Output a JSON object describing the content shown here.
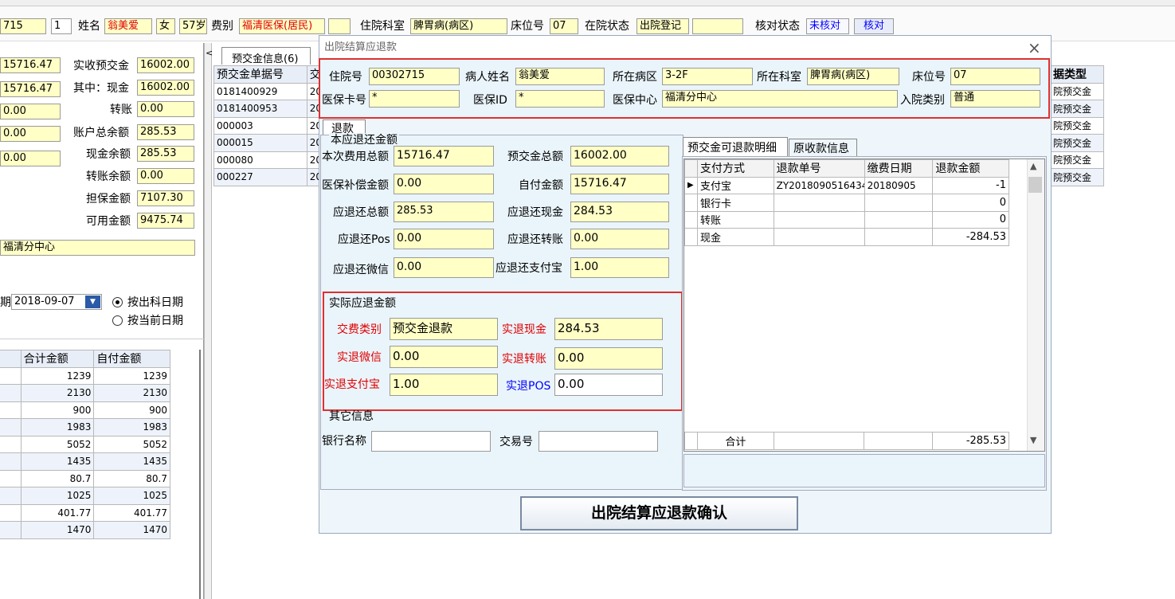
{
  "topbar": {
    "inpatient_no": "715",
    "number": "1",
    "name_label": "姓名",
    "name": "翁美爱",
    "gender": "女",
    "age": "57岁",
    "fee_label": "费别",
    "fee_type": "福清医保(居民)",
    "dept_label": "住院科室",
    "dept": "脾胃病(病区)",
    "bed_label": "床位号",
    "bed": "07",
    "status_label": "在院状态",
    "status": "出院登记",
    "check_label": "核对状态",
    "check_status": "未核对",
    "check_button": "核对"
  },
  "left": {
    "values1": [
      "15716.47",
      "15716.47",
      "0.00",
      "0.00",
      "0.00"
    ],
    "rows": [
      {
        "label": "实收预交金",
        "value": "16002.00"
      },
      {
        "label": "其中：现金",
        "value": "16002.00"
      },
      {
        "label": "转账",
        "value": "0.00"
      },
      {
        "label": "账户总余额",
        "value": "285.53"
      },
      {
        "label": "现金余额",
        "value": "285.53"
      },
      {
        "label": "转账余额",
        "value": "0.00"
      },
      {
        "label": "担保金额",
        "value": "7107.30"
      },
      {
        "label": "可用金额",
        "value": "9475.74"
      }
    ],
    "center": "福清分中心",
    "date_label": "期",
    "date": "2018-09-07",
    "radio1": "按出科日期",
    "radio2": "按当前日期",
    "table_headers": [
      "合计金额",
      "自付金额"
    ],
    "table_rows": [
      [
        "1239",
        "1239"
      ],
      [
        "2130",
        "2130"
      ],
      [
        "900",
        "900"
      ],
      [
        "1983",
        "1983"
      ],
      [
        "5052",
        "5052"
      ],
      [
        "1435",
        "1435"
      ],
      [
        "80.7",
        "80.7"
      ],
      [
        "1025",
        "1025"
      ],
      [
        "401.77",
        "401.77"
      ],
      [
        "1470",
        "1470"
      ]
    ]
  },
  "mid": {
    "tab": "预交金信息(6)",
    "header": "预交金单据号",
    "header2": "交",
    "rows": [
      [
        "0181400929",
        "20"
      ],
      [
        "0181400953",
        "20"
      ],
      [
        "000003",
        "20"
      ],
      [
        "000015",
        "20"
      ],
      [
        "000080",
        "20"
      ],
      [
        "000227",
        "20"
      ]
    ]
  },
  "right": {
    "header": "据类型",
    "rows": [
      "院预交金",
      "院预交金",
      "院预交金",
      "院预交金",
      "院预交金",
      "院预交金"
    ]
  },
  "dialog": {
    "title": "出院结算应退款",
    "close": "×",
    "info": {
      "inpatient_no_label": "住院号",
      "inpatient_no": "00302715",
      "name_label": "病人姓名",
      "name": "翁美爱",
      "ward_label": "所在病区",
      "ward": "3-2F",
      "dept_label": "所在科室",
      "dept": "脾胃病(病区)",
      "bed_label": "床位号",
      "bed": "07",
      "card_label": "医保卡号",
      "card": "*",
      "insid_label": "医保ID",
      "insid": "*",
      "center_label": "医保中心",
      "center": "福清分中心",
      "admit_label": "入院类别",
      "admit": "普通"
    },
    "tab_refund": "退款",
    "section1": "本应退还金额",
    "total_fee_label": "本次费用总额",
    "total_fee": "15716.47",
    "deposit_total_label": "预交金总额",
    "deposit_total": "16002.00",
    "insurance_label": "医保补偿金额",
    "insurance": "0.00",
    "selfpay_label": "自付金额",
    "selfpay": "15716.47",
    "refund_total_label": "应退还总额",
    "refund_total": "285.53",
    "refund_cash_label": "应退还现金",
    "refund_cash": "284.53",
    "refund_pos_label": "应退还Pos",
    "refund_pos": "0.00",
    "refund_transfer_label": "应退还转账",
    "refund_transfer": "0.00",
    "refund_wechat_label": "应退还微信",
    "refund_wechat": "0.00",
    "refund_alipay_label": "应退还支付宝",
    "refund_alipay": "1.00",
    "section2": "实际应退金额",
    "pay_type_label": "交费类别",
    "pay_type": "预交金退款",
    "act_cash_label": "实退现金",
    "act_cash": "284.53",
    "act_wechat_label": "实退微信",
    "act_wechat": "0.00",
    "act_transfer_label": "实退转账",
    "act_transfer": "0.00",
    "act_alipay_label": "实退支付宝",
    "act_alipay": "1.00",
    "act_pos_label": "实退POS",
    "act_pos": "0.00",
    "section3": "其它信息",
    "bank_label": "银行名称",
    "bank": "",
    "trade_label": "交易号",
    "trade": "",
    "tab_detail": "预交金可退款明细",
    "tab_orig": "原收款信息",
    "grid_headers": [
      "支付方式",
      "退款单号",
      "缴费日期",
      "退款金额"
    ],
    "grid_rows": [
      [
        "支付宝",
        "ZY2018090516434",
        "20180905",
        "-1"
      ],
      [
        "银行卡",
        "",
        "",
        "0"
      ],
      [
        "转账",
        "",
        "",
        "0"
      ],
      [
        "现金",
        "",
        "",
        "-284.53"
      ]
    ],
    "sum_label": "合计",
    "sum": "-285.53",
    "confirm": "出院结算应退款确认"
  }
}
